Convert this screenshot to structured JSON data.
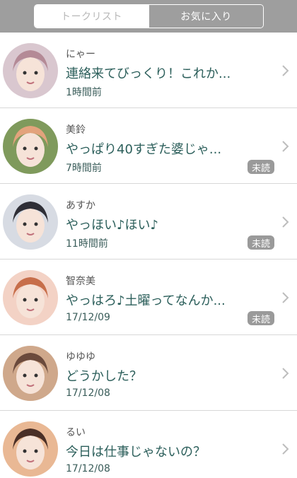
{
  "tabs": {
    "talk_list": "トークリスト",
    "favorites": "お気に入り"
  },
  "rows": [
    {
      "name": "にゃー",
      "message": "連絡来てびっくり！これか...",
      "time": "1時間前",
      "badge": "",
      "bg": "#d9c7cf",
      "fg": "#b48a96"
    },
    {
      "name": "美鈴",
      "message": "やっぱり40すぎた婆じゃ...",
      "time": "7時間前",
      "badge": "未読",
      "bg": "#7f9a5c",
      "fg": "#e3a37c"
    },
    {
      "name": "あすか",
      "message": "やっほい♪ほい♪",
      "time": "11時間前",
      "badge": "未読",
      "bg": "#d7dbe3",
      "fg": "#2e2e36"
    },
    {
      "name": "智奈美",
      "message": "やっはろ♪土曜ってなんか...",
      "time": "17/12/09",
      "badge": "未読",
      "bg": "#f3d2c5",
      "fg": "#c76e4a"
    },
    {
      "name": "ゆゆゆ",
      "message": "どうかした？",
      "time": "17/12/08",
      "badge": "",
      "bg": "#cfa88b",
      "fg": "#6b4a3c"
    },
    {
      "name": "るい",
      "message": "今日は仕事じゃないの？",
      "time": "17/12/08",
      "badge": "",
      "bg": "#e9b894",
      "fg": "#4a2f26"
    }
  ],
  "colors": {
    "accent_text": "#2c5f5b",
    "badge_bg": "#9a9a9a",
    "header_bg": "#9e9e9e"
  },
  "icons": {
    "chevron": "chevron-right-icon",
    "avatar": "user-photo"
  }
}
